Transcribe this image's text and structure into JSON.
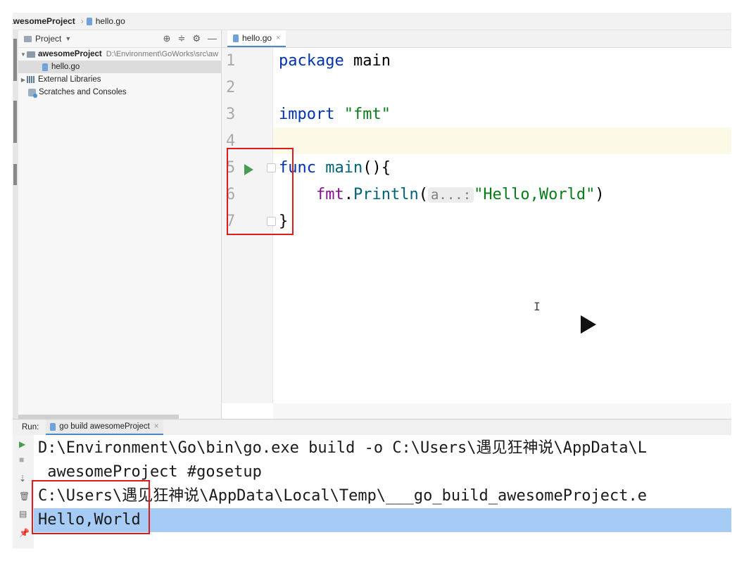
{
  "breadcrumb": {
    "project": "awesomeProject",
    "file": "hello.go"
  },
  "project_panel": {
    "title": "Project",
    "tree": [
      {
        "label": "awesomeProject",
        "path": "D:\\Environment\\GoWorks\\src\\aw"
      },
      {
        "label": "hello.go"
      },
      {
        "label": "External Libraries"
      },
      {
        "label": "Scratches and Consoles"
      }
    ]
  },
  "editor": {
    "tab_label": "hello.go",
    "line_numbers": [
      "1",
      "2",
      "3",
      "4",
      "5",
      "6",
      "7"
    ],
    "code": {
      "l1_kw": "package",
      "l1_name": " main",
      "l3_kw": "import",
      "l3_str": " \"fmt\"",
      "l5_kw": "func",
      "l5_fn": " main",
      "l5_rest": "(){",
      "l6_pkg": "    fmt",
      "l6_dot": ".",
      "l6_fn": "Println",
      "l6_paren": "(",
      "l6_hint": "a...:",
      "l6_str": "\"Hello,World\"",
      "l6_close": ")",
      "l7": "}"
    }
  },
  "run_panel": {
    "label": "Run:",
    "tab_label": "go build awesomeProject",
    "lines": [
      "D:\\Environment\\Go\\bin\\go.exe build -o C:\\Users\\遇见狂神说\\AppData\\L",
      " awesomeProject #gosetup",
      "C:\\Users\\遇见狂神说\\AppData\\Local\\Temp\\___go_build_awesomeProject.e",
      "Hello,World"
    ]
  },
  "colors": {
    "keyword": "#0033b3",
    "string": "#067d17",
    "run_icon": "#499c54",
    "highlight": "#a6cbf5",
    "annotation": "#e01b1b"
  },
  "icons": [
    "folder-icon",
    "go-file-icon",
    "library-icon",
    "scratches-icon",
    "run-gutter-icon",
    "play-overlay-icon",
    "text-cursor-icon"
  ]
}
